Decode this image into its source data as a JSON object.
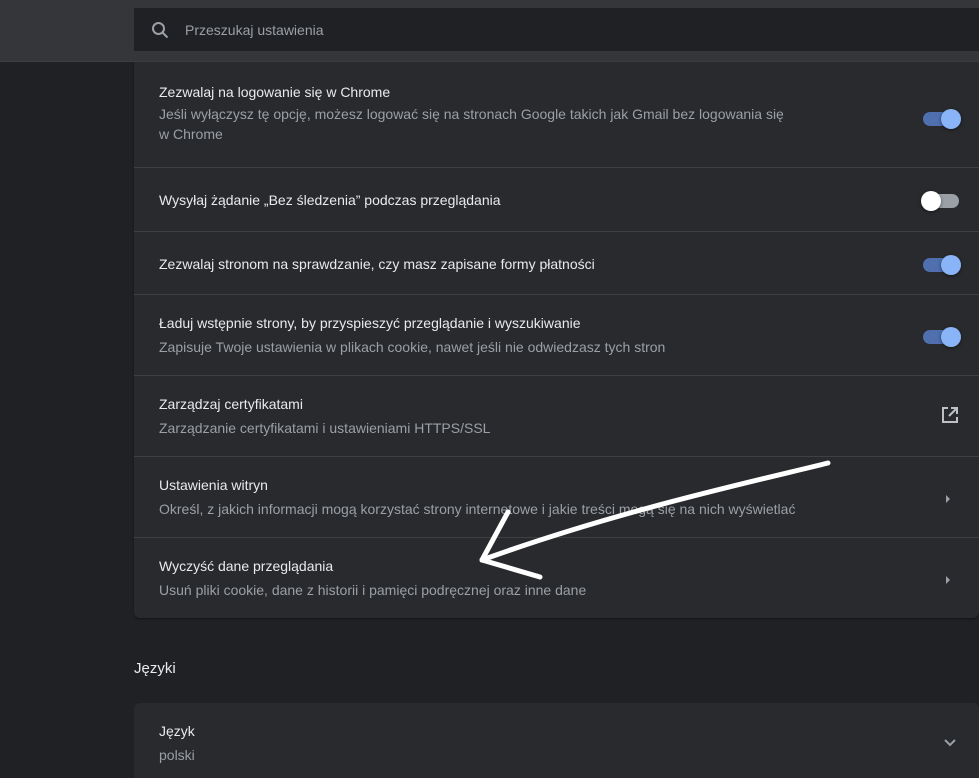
{
  "search": {
    "placeholder": "Przeszukaj ustawienia"
  },
  "privacy_settings": [
    {
      "title": "Zezwalaj na logowanie się w Chrome",
      "subtitle_line1": "Jeśli wyłączysz tę opcję, możesz logować się na stronach Google takich jak Gmail bez logowania się",
      "subtitle_line2": "w Chrome",
      "control": "toggle",
      "toggle_state": "on"
    },
    {
      "title": "Wysyłaj żądanie „Bez śledzenia” podczas przeglądania",
      "control": "toggle",
      "toggle_state": "off"
    },
    {
      "title": "Zezwalaj stronom na sprawdzanie, czy masz zapisane formy płatności",
      "control": "toggle",
      "toggle_state": "on"
    },
    {
      "title": "Ładuj wstępnie strony, by przyspieszyć przeglądanie i wyszukiwanie",
      "subtitle_line1": "Zapisuje Twoje ustawienia w plikach cookie, nawet jeśli nie odwiedzasz tych stron",
      "control": "toggle",
      "toggle_state": "on"
    },
    {
      "title": "Zarządzaj certyfikatami",
      "subtitle_line1": "Zarządzanie certyfikatami i ustawieniami HTTPS/SSL",
      "control": "external-link-icon"
    },
    {
      "title": "Ustawienia witryn",
      "subtitle_line1": "Określ, z jakich informacji mogą korzystać strony internetowe i jakie treści mogą się na nich wyświetlać",
      "control": "chevron-right-icon"
    },
    {
      "title": "Wyczyść dane przeglądania",
      "subtitle_line1": "Usuń pliki cookie, dane z historii i pamięci podręcznej oraz inne dane",
      "control": "chevron-right-icon"
    }
  ],
  "languages_section": {
    "title": "Języki",
    "language_row": {
      "title": "Język",
      "value": "polski",
      "control": "chevron-down-icon"
    }
  },
  "colors": {
    "background": "#202124",
    "card": "#292a2d",
    "toggle_on_track": "#4f6fae",
    "toggle_on_knob": "#8ab4f8",
    "annotation_arrow": "#ffffff"
  }
}
